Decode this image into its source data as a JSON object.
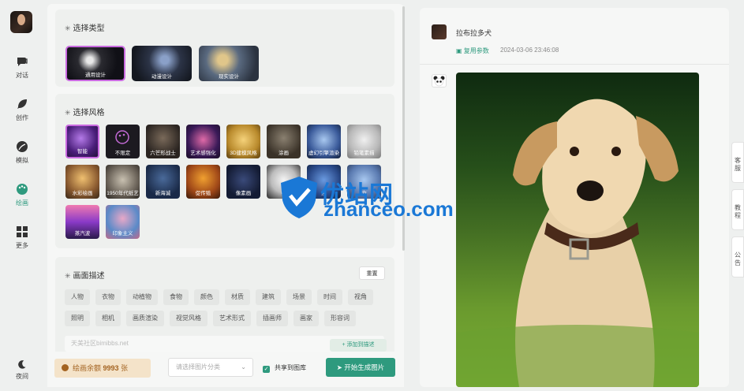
{
  "nav": {
    "items": [
      {
        "label": "对话",
        "icon": "chat-icon"
      },
      {
        "label": "创作",
        "icon": "feather-icon"
      },
      {
        "label": "模拟",
        "icon": "leaf-icon"
      },
      {
        "label": "绘画",
        "icon": "palette-icon",
        "active": true
      },
      {
        "label": "更多",
        "icon": "grid-icon"
      }
    ],
    "night_label": "夜间"
  },
  "type_section": {
    "title": "选择类型",
    "items": [
      {
        "label": "通用设计",
        "selected": true
      },
      {
        "label": "动漫设计"
      },
      {
        "label": "现实设计"
      }
    ]
  },
  "style_section": {
    "title": "选择风格",
    "items": [
      {
        "label": "智能",
        "selected": true
      },
      {
        "label": "不限定"
      },
      {
        "label": "六芒形战士"
      },
      {
        "label": "艺术感强化"
      },
      {
        "label": "3D建模风格"
      },
      {
        "label": "涂画"
      },
      {
        "label": "虚幻引擎渲染"
      },
      {
        "label": "铅笔素描"
      },
      {
        "label": "水彩绘画"
      },
      {
        "label": "1950年代纸艺"
      },
      {
        "label": "新海诚"
      },
      {
        "label": "促传殖"
      },
      {
        "label": "像素画"
      },
      {
        "label": "中"
      },
      {
        "label": "照"
      },
      {
        "label": "力"
      },
      {
        "label": "蒸汽波"
      },
      {
        "label": "印象主义"
      }
    ]
  },
  "desc_section": {
    "title": "画面描述",
    "reset_label": "重置",
    "tags_row1": [
      "人物",
      "衣物",
      "动植物",
      "食物",
      "颜色",
      "材质",
      "建筑",
      "场景",
      "时间",
      "视角"
    ],
    "tags_row2": [
      "照明",
      "相机",
      "画质渲染",
      "视觉风格",
      "艺术形式",
      "插画师",
      "画家",
      "形容词"
    ],
    "input_placeholder": "天美社区bimibbs.net",
    "add_desc_label": "+ 添加到描述"
  },
  "bottom": {
    "balance_prefix": "绘画余额",
    "balance_value": "9993",
    "balance_unit": "张",
    "select_placeholder": "请选择图片分类",
    "share_label": "共享到图库",
    "generate_label": "开始生成图片"
  },
  "result": {
    "username": "拉布拉多犬",
    "reuse_label": "复用参数",
    "timestamp": "2024-03-06 23:46:08"
  },
  "rail": [
    "客服",
    "教程",
    "公告"
  ],
  "watermark": {
    "cn": "优站网",
    "en": "zhanceo.com"
  },
  "colors": {
    "accent": "#2e9a7e",
    "selected_border": "#c96ae0",
    "balance_bg": "#f4e3c9"
  }
}
